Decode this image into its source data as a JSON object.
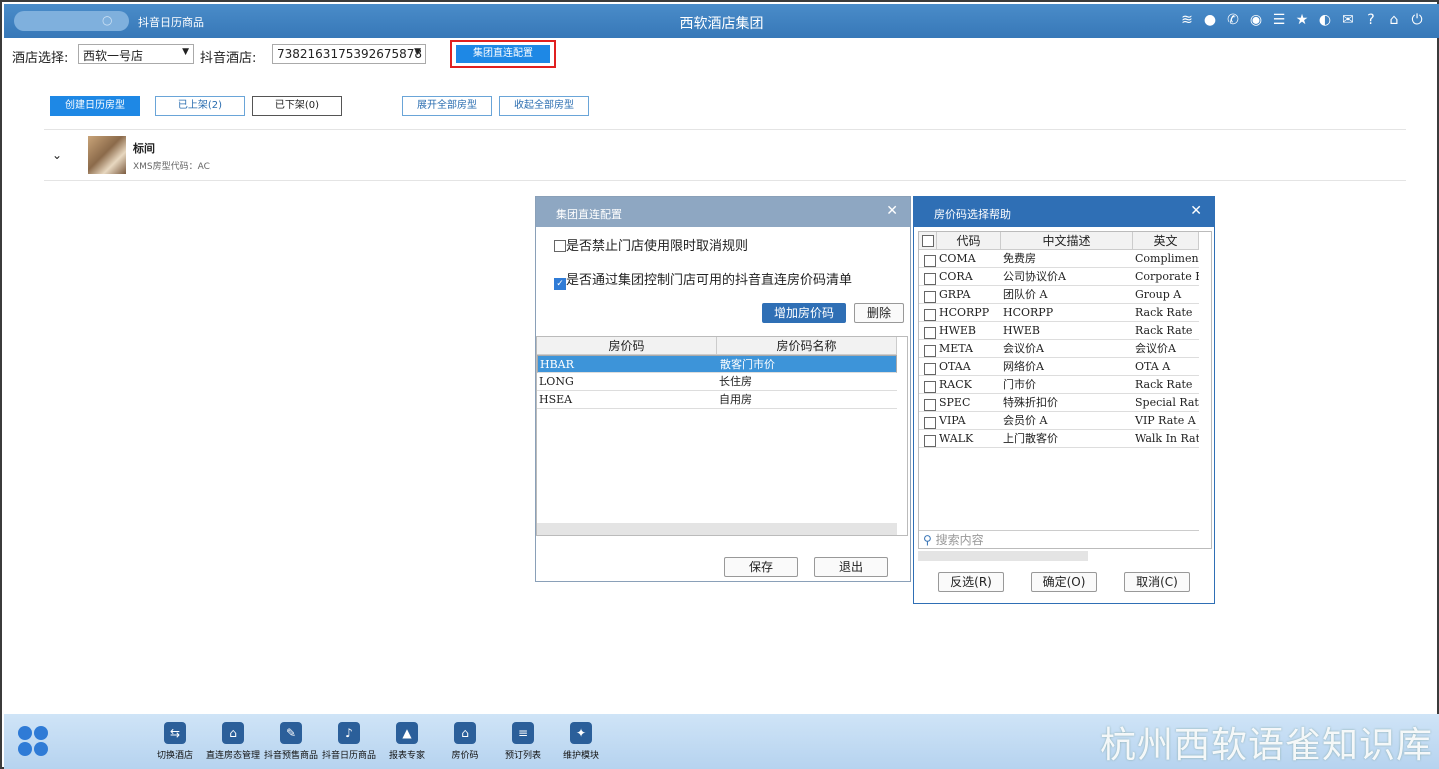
{
  "titlebar": {
    "app_tab": "抖音日历商品",
    "title": "西软酒店集团",
    "icons": [
      "wifi-icon",
      "chat-icon",
      "phone-icon",
      "palette-icon",
      "menu-icon",
      "star-icon",
      "contrast-icon",
      "mail-icon",
      "help-icon",
      "home-icon",
      "power-icon"
    ]
  },
  "filter": {
    "hotel_label": "酒店选择:",
    "hotel_value": "西软一号店",
    "douyin_label": "抖音酒店:",
    "douyin_value": "7382163175392675878",
    "group_config_button": "集团直连配置"
  },
  "toolbar": {
    "create": "创建日历房型",
    "listed": "已上架(2)",
    "unlisted": "已下架(0)",
    "expand_all": "展开全部房型",
    "collapse_all": "收起全部房型"
  },
  "room": {
    "name": "标间",
    "code": "XMS房型代码：AC"
  },
  "group_dialog": {
    "title": "集团直连配置",
    "option1": "是否禁止门店使用限时取消规则",
    "option1_checked": false,
    "option2": "是否通过集团控制门店可用的抖音直连房价码清单",
    "option2_checked": true,
    "add_button": "增加房价码",
    "delete_button": "删除",
    "columns": [
      "房价码",
      "房价码名称"
    ],
    "rows": [
      {
        "code": "HBAR",
        "name": "散客门市价"
      },
      {
        "code": "LONG",
        "name": "长住房"
      },
      {
        "code": "HSEA",
        "name": "自用房"
      }
    ],
    "save_button": "保存",
    "exit_button": "退出"
  },
  "help_dialog": {
    "title": "房价码选择帮助",
    "columns": [
      "代码",
      "中文描述",
      "英文"
    ],
    "rows": [
      {
        "code": "COMA",
        "cn": "免费房",
        "en": "Compliment"
      },
      {
        "code": "CORA",
        "cn": "公司协议价A",
        "en": "Corporate R"
      },
      {
        "code": "GRPA",
        "cn": "团队价 A",
        "en": "Group A"
      },
      {
        "code": "HCORPP",
        "cn": "HCORPP",
        "en": "Rack Rate"
      },
      {
        "code": "HWEB",
        "cn": "HWEB",
        "en": "Rack Rate"
      },
      {
        "code": "META",
        "cn": "会议价A",
        "en": "会议价A"
      },
      {
        "code": "OTAA",
        "cn": "网络价A",
        "en": "OTA A"
      },
      {
        "code": "RACK",
        "cn": "门市价",
        "en": "Rack Rate"
      },
      {
        "code": "SPEC",
        "cn": "特殊折扣价",
        "en": "Special Rat"
      },
      {
        "code": "VIPA",
        "cn": "会员价 A",
        "en": "VIP Rate A"
      },
      {
        "code": "WALK",
        "cn": "上门散客价",
        "en": "Walk In Rat"
      }
    ],
    "search_placeholder": "搜索内容",
    "invert_button": "反选(R)",
    "ok_button": "确定(O)",
    "cancel_button": "取消(C)"
  },
  "bottom_nav": [
    {
      "label": "切换酒店",
      "icon": "switch-icon",
      "glyph": "⇆"
    },
    {
      "label": "直连房态管理",
      "icon": "house-gear-icon",
      "glyph": "⌂"
    },
    {
      "label": "抖音预售商品",
      "icon": "edit-doc-icon",
      "glyph": "✎"
    },
    {
      "label": "抖音日历商品",
      "icon": "tiktok-icon",
      "glyph": "♪"
    },
    {
      "label": "报表专家",
      "icon": "graduation-icon",
      "glyph": "▲"
    },
    {
      "label": "房价码",
      "icon": "house-icon",
      "glyph": "⌂"
    },
    {
      "label": "预订列表",
      "icon": "document-icon",
      "glyph": "≡"
    },
    {
      "label": "维护模块",
      "icon": "wrench-icon",
      "glyph": "✦"
    }
  ],
  "watermark": "杭州西软语雀知识库"
}
